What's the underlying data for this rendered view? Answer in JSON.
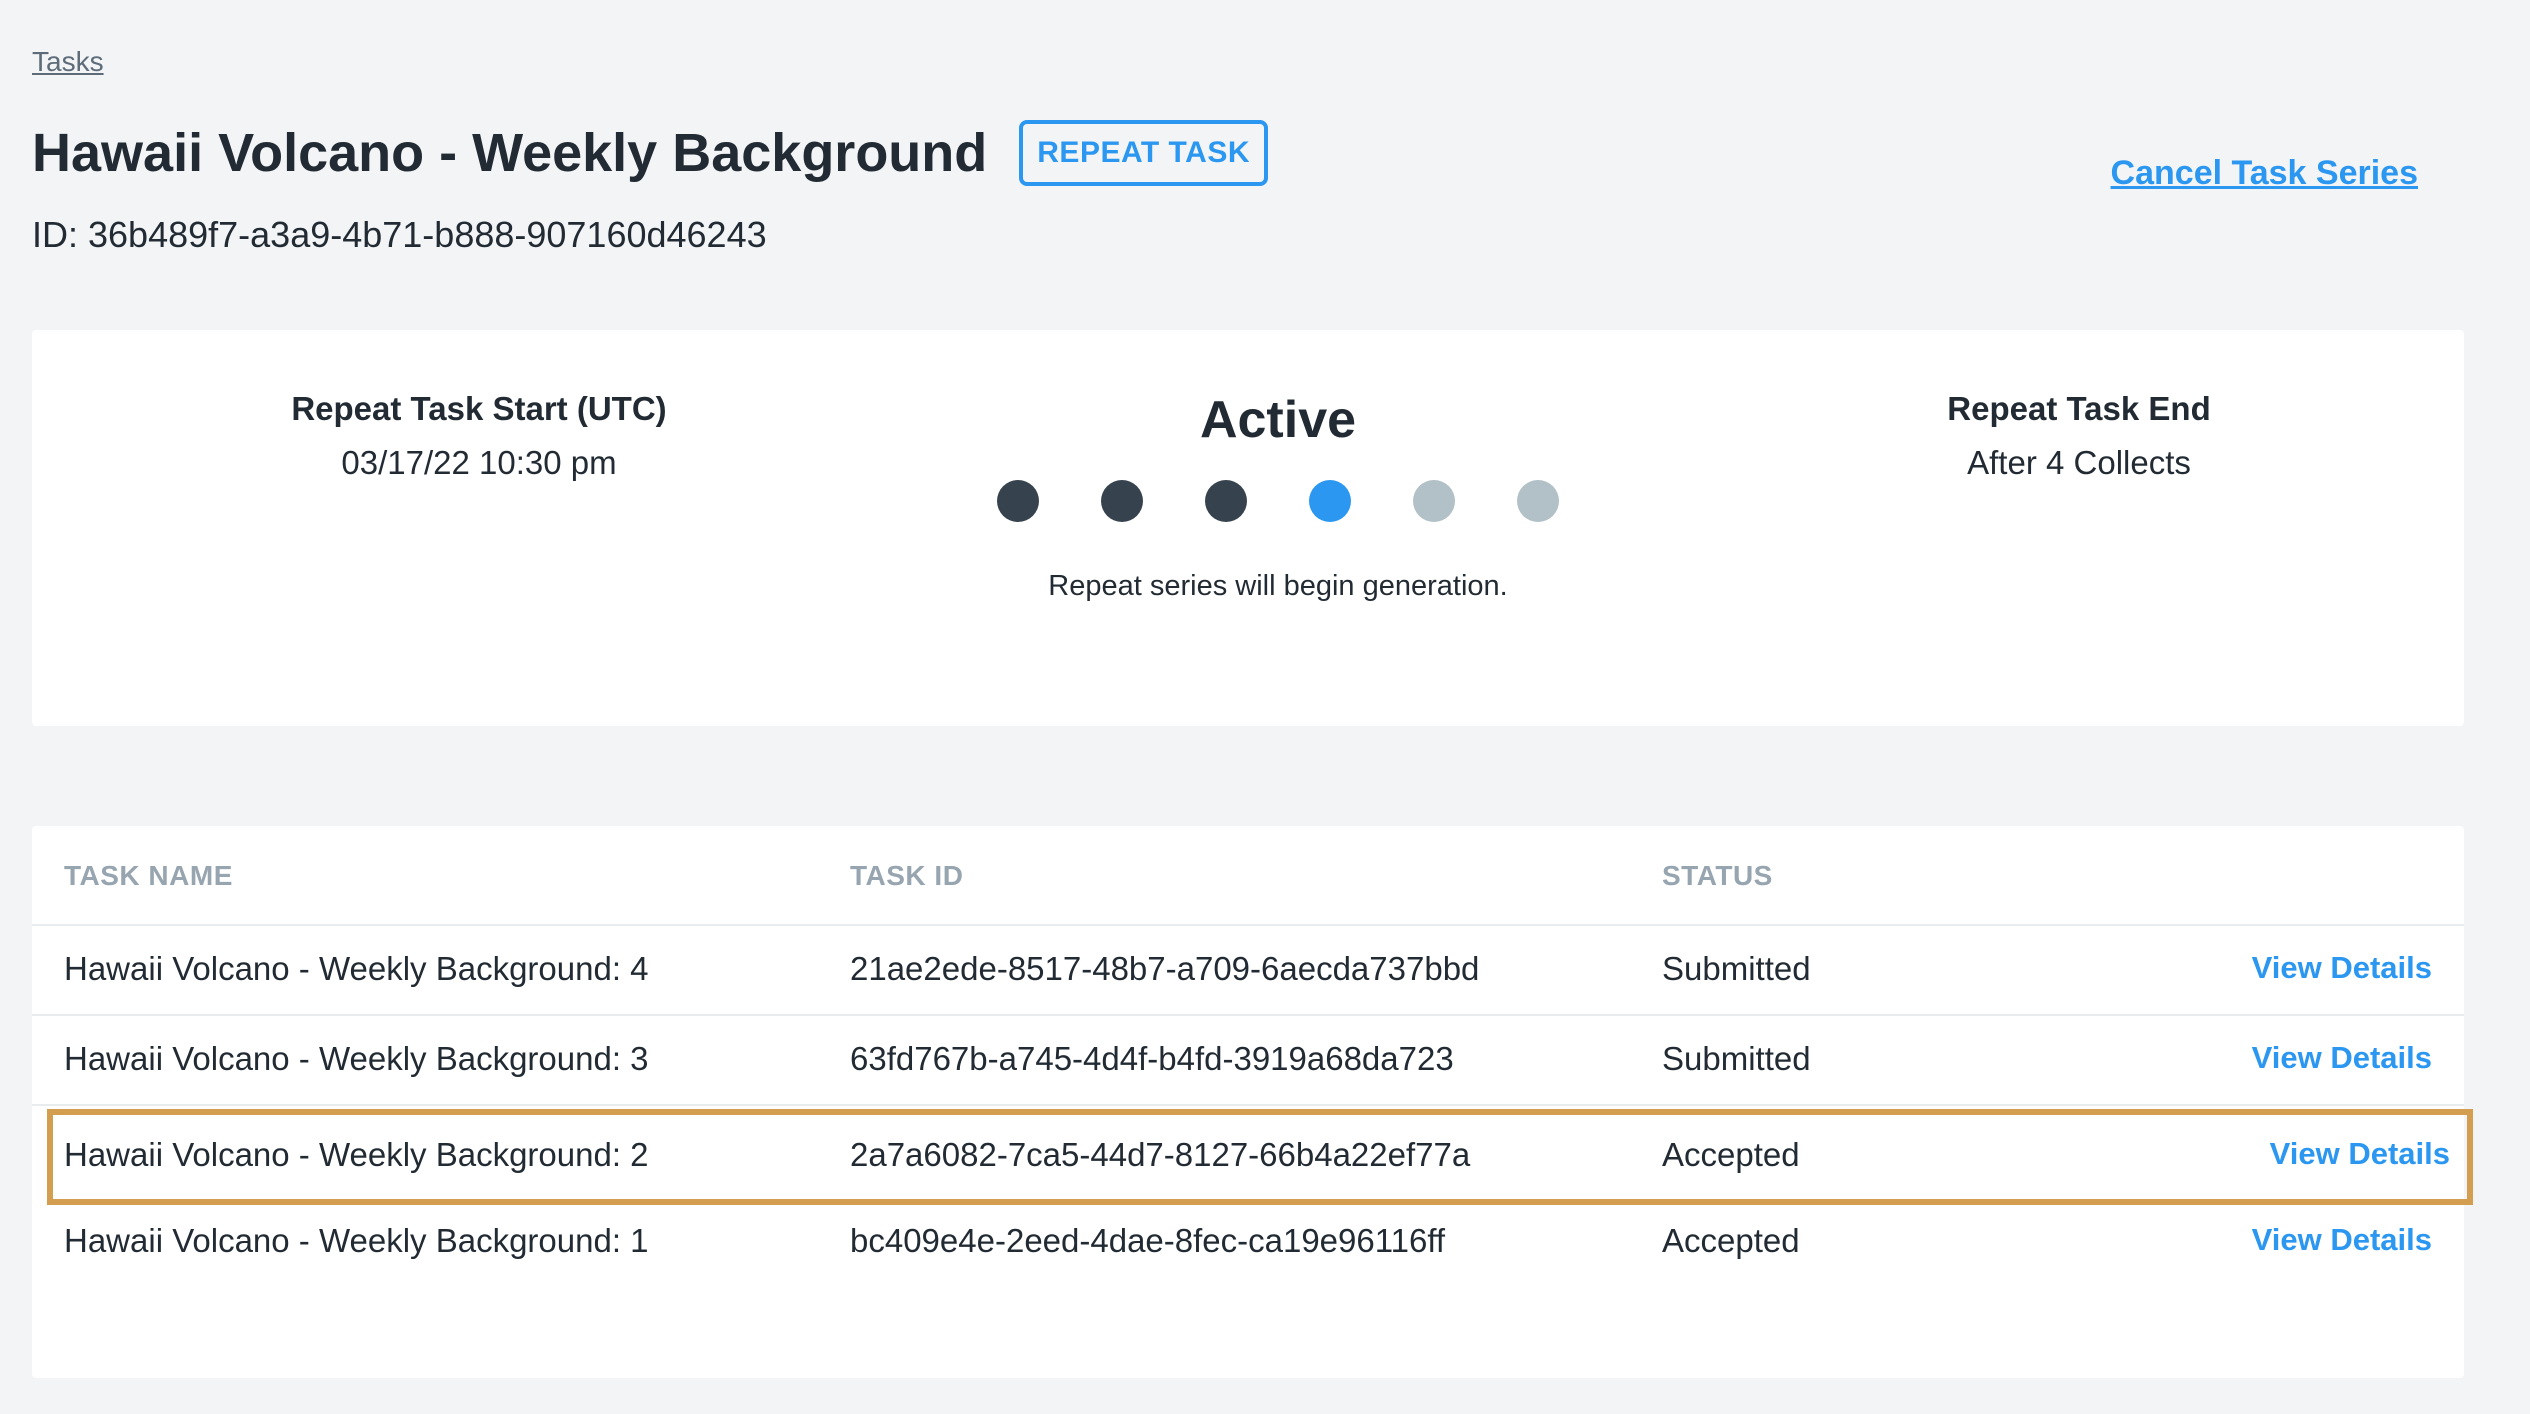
{
  "breadcrumb": {
    "label": "Tasks"
  },
  "header": {
    "title": "Hawaii Volcano - Weekly Background",
    "badge": "REPEAT TASK",
    "id_line": "ID: 36b489f7-a3a9-4b71-b888-907160d46243",
    "cancel_label": "Cancel Task Series"
  },
  "status_card": {
    "start_label": "Repeat Task Start (UTC)",
    "start_value": "03/17/22 10:30 pm",
    "status": "Active",
    "note": "Repeat series will begin generation.",
    "end_label": "Repeat Task End",
    "end_value": "After 4 Collects",
    "progress_dots": [
      {
        "state": "done",
        "color": "#36434e"
      },
      {
        "state": "done",
        "color": "#36434e"
      },
      {
        "state": "done",
        "color": "#36434e"
      },
      {
        "state": "current",
        "color": "#2b97f0"
      },
      {
        "state": "pending",
        "color": "#b2c0c8"
      },
      {
        "state": "pending",
        "color": "#b2c0c8"
      }
    ]
  },
  "table": {
    "columns": [
      "TASK NAME",
      "TASK ID",
      "STATUS"
    ],
    "rows": [
      {
        "name": "Hawaii Volcano - Weekly Background: 4",
        "id": "21ae2ede-8517-48b7-a709-6aecda737bbd",
        "status": "Submitted",
        "action": "View Details",
        "highlighted": false
      },
      {
        "name": "Hawaii Volcano - Weekly Background: 3",
        "id": "63fd767b-a745-4d4f-b4fd-3919a68da723",
        "status": "Submitted",
        "action": "View Details",
        "highlighted": false
      },
      {
        "name": "Hawaii Volcano - Weekly Background: 2",
        "id": "2a7a6082-7ca5-44d7-8127-66b4a22ef77a",
        "status": "Accepted",
        "action": "View Details",
        "highlighted": true
      },
      {
        "name": "Hawaii Volcano - Weekly Background: 1",
        "id": "bc409e4e-2eed-4dae-8fec-ca19e96116ff",
        "status": "Accepted",
        "action": "View Details",
        "highlighted": false
      }
    ]
  },
  "colors": {
    "accent": "#2b97f0",
    "highlight_outline": "#d49e50",
    "background": "#f2f4f6"
  }
}
